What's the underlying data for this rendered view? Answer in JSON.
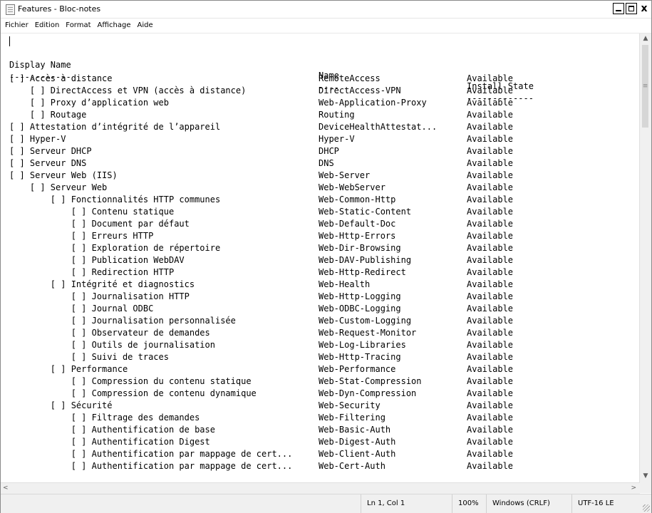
{
  "window": {
    "title": "Features - Bloc-notes",
    "minimize": "minimize",
    "maximize": "maximize",
    "close": "x"
  },
  "menu": [
    "Fichier",
    "Edition",
    "Format",
    "Affichage",
    "Aide"
  ],
  "header": {
    "display": "Display Name",
    "name": "Name",
    "state": "Install State"
  },
  "separator": {
    "display": "------------",
    "name": "----",
    "state": "-------------"
  },
  "rows": [
    {
      "display": "[ ] Accès à distance",
      "name": "RemoteAccess",
      "state": "Available"
    },
    {
      "display": "    [ ] DirectAccess et VPN (accès à distance)",
      "name": "DirectAccess-VPN",
      "state": "Available"
    },
    {
      "display": "    [ ] Proxy d’application web",
      "name": "Web-Application-Proxy",
      "state": "Available"
    },
    {
      "display": "    [ ] Routage",
      "name": "Routing",
      "state": "Available"
    },
    {
      "display": "[ ] Attestation d’intégrité de l’appareil",
      "name": "DeviceHealthAttestat...",
      "state": "Available"
    },
    {
      "display": "[ ] Hyper-V",
      "name": "Hyper-V",
      "state": "Available"
    },
    {
      "display": "[ ] Serveur DHCP",
      "name": "DHCP",
      "state": "Available"
    },
    {
      "display": "[ ] Serveur DNS",
      "name": "DNS",
      "state": "Available"
    },
    {
      "display": "[ ] Serveur Web (IIS)",
      "name": "Web-Server",
      "state": "Available"
    },
    {
      "display": "    [ ] Serveur Web",
      "name": "Web-WebServer",
      "state": "Available"
    },
    {
      "display": "        [ ] Fonctionnalités HTTP communes",
      "name": "Web-Common-Http",
      "state": "Available"
    },
    {
      "display": "            [ ] Contenu statique",
      "name": "Web-Static-Content",
      "state": "Available"
    },
    {
      "display": "            [ ] Document par défaut",
      "name": "Web-Default-Doc",
      "state": "Available"
    },
    {
      "display": "            [ ] Erreurs HTTP",
      "name": "Web-Http-Errors",
      "state": "Available"
    },
    {
      "display": "            [ ] Exploration de répertoire",
      "name": "Web-Dir-Browsing",
      "state": "Available"
    },
    {
      "display": "            [ ] Publication WebDAV",
      "name": "Web-DAV-Publishing",
      "state": "Available"
    },
    {
      "display": "            [ ] Redirection HTTP",
      "name": "Web-Http-Redirect",
      "state": "Available"
    },
    {
      "display": "        [ ] Intégrité et diagnostics",
      "name": "Web-Health",
      "state": "Available"
    },
    {
      "display": "            [ ] Journalisation HTTP",
      "name": "Web-Http-Logging",
      "state": "Available"
    },
    {
      "display": "            [ ] Journal ODBC",
      "name": "Web-ODBC-Logging",
      "state": "Available"
    },
    {
      "display": "            [ ] Journalisation personnalisée",
      "name": "Web-Custom-Logging",
      "state": "Available"
    },
    {
      "display": "            [ ] Observateur de demandes",
      "name": "Web-Request-Monitor",
      "state": "Available"
    },
    {
      "display": "            [ ] Outils de journalisation",
      "name": "Web-Log-Libraries",
      "state": "Available"
    },
    {
      "display": "            [ ] Suivi de traces",
      "name": "Web-Http-Tracing",
      "state": "Available"
    },
    {
      "display": "        [ ] Performance",
      "name": "Web-Performance",
      "state": "Available"
    },
    {
      "display": "            [ ] Compression du contenu statique",
      "name": "Web-Stat-Compression",
      "state": "Available"
    },
    {
      "display": "            [ ] Compression de contenu dynamique",
      "name": "Web-Dyn-Compression",
      "state": "Available"
    },
    {
      "display": "        [ ] Sécurité",
      "name": "Web-Security",
      "state": "Available"
    },
    {
      "display": "            [ ] Filtrage des demandes",
      "name": "Web-Filtering",
      "state": "Available"
    },
    {
      "display": "            [ ] Authentification de base",
      "name": "Web-Basic-Auth",
      "state": "Available"
    },
    {
      "display": "            [ ] Authentification Digest",
      "name": "Web-Digest-Auth",
      "state": "Available"
    },
    {
      "display": "            [ ] Authentification par mappage de cert...",
      "name": "Web-Client-Auth",
      "state": "Available"
    },
    {
      "display": "            [ ] Authentification par mappage de cert...",
      "name": "Web-Cert-Auth",
      "state": "Available"
    }
  ],
  "status": {
    "position": "Ln 1, Col 1",
    "zoom": "100%",
    "line_ending": "Windows (CRLF)",
    "encoding": "UTF-16 LE"
  },
  "icons": {
    "scroll_up": "▲",
    "scroll_down": "▼",
    "scroll_left": "<",
    "scroll_right": ">",
    "thumb_grip": "≡"
  }
}
